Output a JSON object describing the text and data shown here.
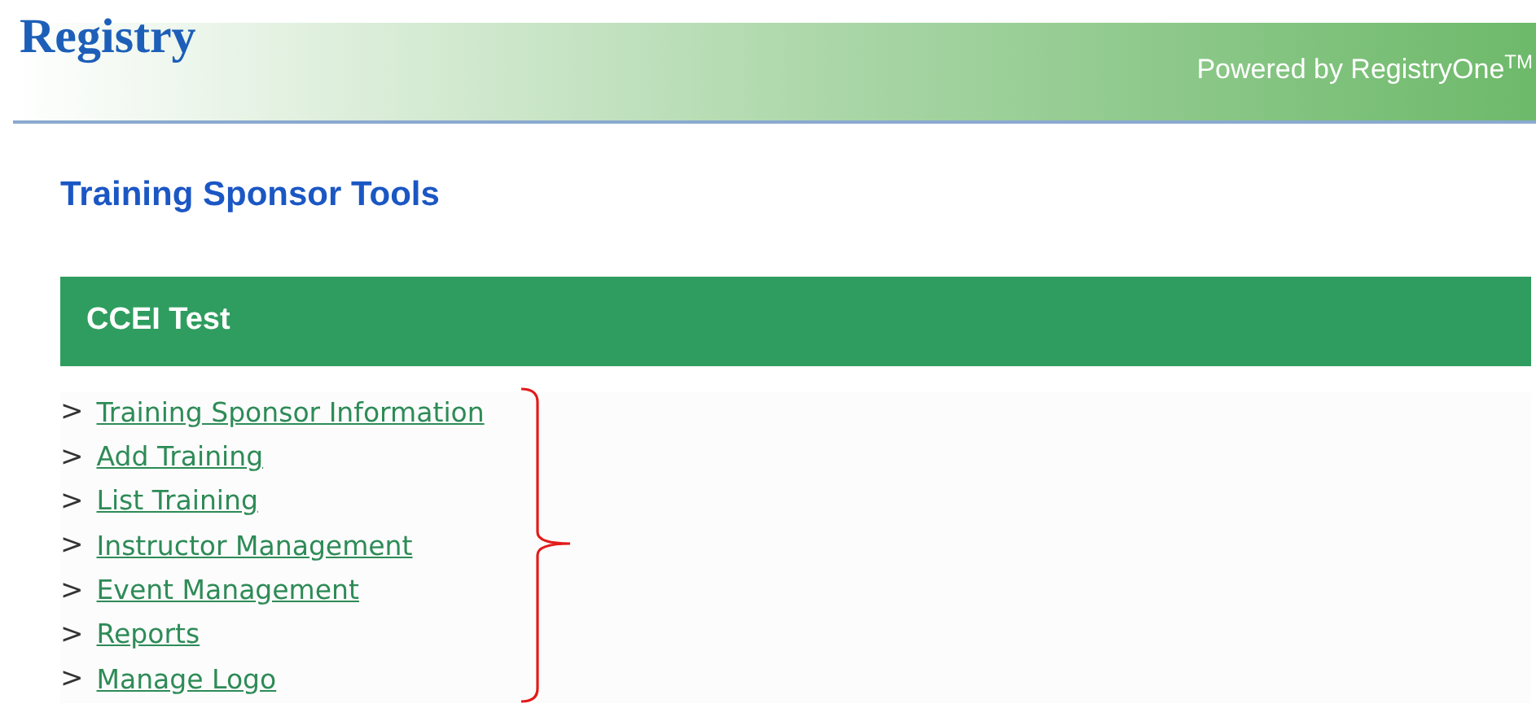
{
  "header": {
    "logo": "Registry",
    "powered_by": "Powered by RegistryOne$^{TM}$"
  },
  "page_title": "Training Sponsor Tools",
  "panel": {
    "title": "CCEI Test",
    "links": [
      {
        "label": "Training Sponsor Information"
      },
      {
        "label": "Add Training"
      },
      {
        "label": "List Training"
      },
      {
        "label": "Instructor Management"
      },
      {
        "label": "Event Management"
      },
      {
        "label": "Reports"
      },
      {
        "label": "Manage Logo"
      }
    ],
    "marker": ">"
  }
}
